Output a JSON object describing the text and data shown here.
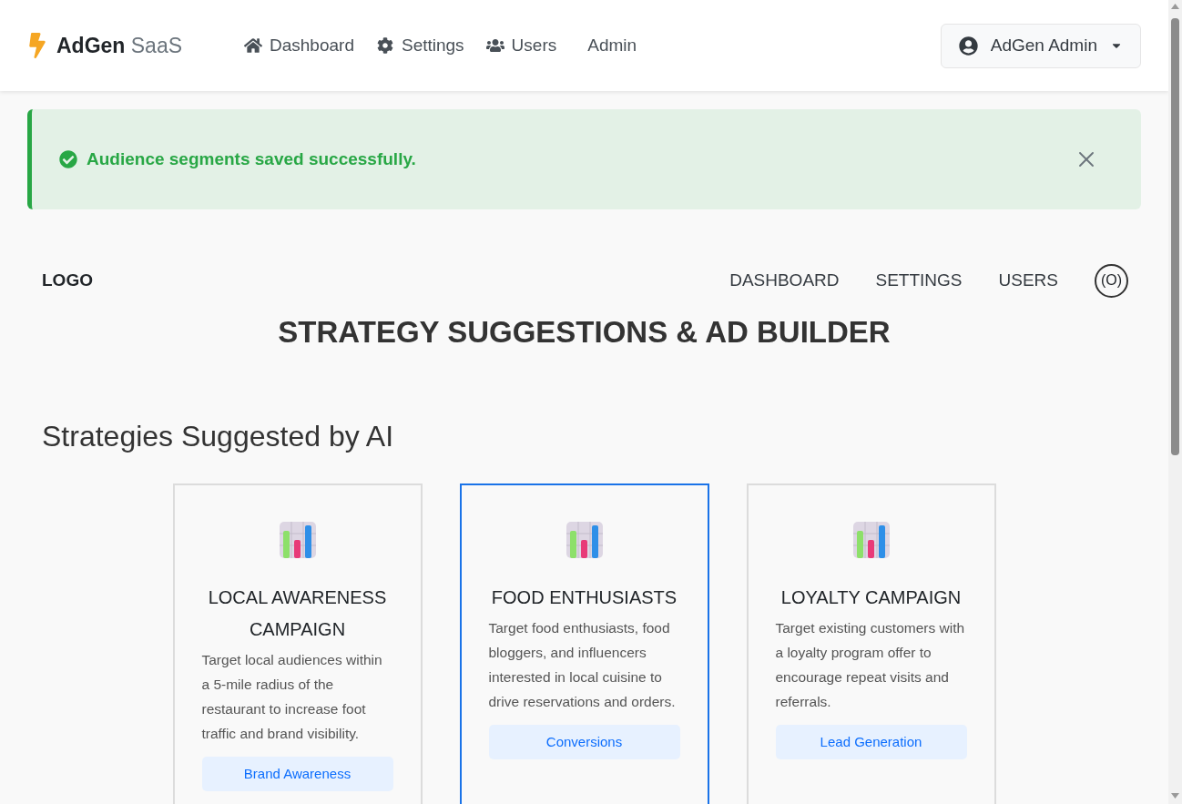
{
  "navbar": {
    "brand": {
      "bold": "AdGen",
      "light": "SaaS"
    },
    "links": [
      {
        "label": "Dashboard"
      },
      {
        "label": "Settings"
      },
      {
        "label": "Users"
      },
      {
        "label": "Admin"
      }
    ],
    "user_menu": {
      "label": "AdGen Admin"
    }
  },
  "alert": {
    "message": "Audience segments saved successfully."
  },
  "inner_nav": {
    "logo": "LOGO",
    "links": [
      "DASHBOARD",
      "SETTINGS",
      "USERS"
    ],
    "profile_glyph": "(O)"
  },
  "page_title": "STRATEGY SUGGESTIONS & AD BUILDER",
  "section_title": "Strategies Suggested by AI",
  "strategies": [
    {
      "title": "LOCAL AWARENESS CAMPAIGN",
      "description": "Target local audiences within a 5-mile radius of the restaurant to increase foot traffic and brand visibility.",
      "tag": "Brand Awareness",
      "selected": false
    },
    {
      "title": "FOOD ENTHUSIASTS",
      "description": "Target food enthusiasts, food bloggers, and influencers interested in local cuisine to drive reservations and orders.",
      "tag": "Conversions",
      "selected": true
    },
    {
      "title": "LOYALTY CAMPAIGN",
      "description": "Target existing customers with a loyalty program offer to encourage repeat visits and referrals.",
      "tag": "Lead Generation",
      "selected": false
    }
  ]
}
